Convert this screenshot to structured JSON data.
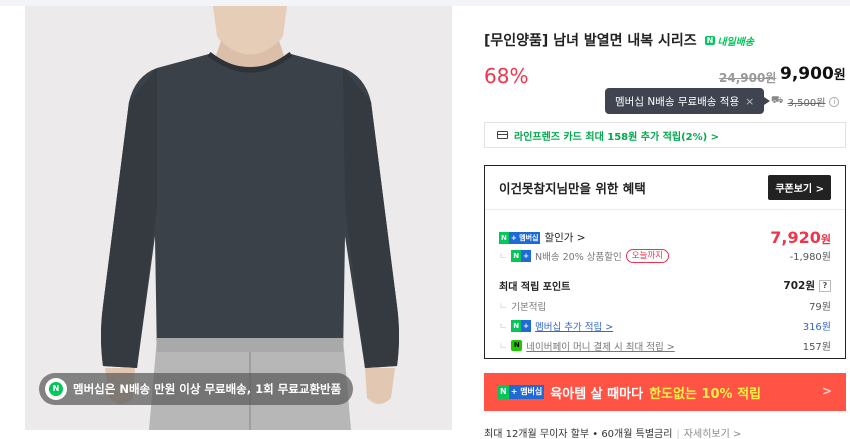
{
  "promo": {
    "text": "멤버십은 N배송 만원 이상 무료배송, 1회 무료교환반품",
    "icon": "N"
  },
  "product": {
    "title": "[무인양품] 남녀 발열면 내복 시리즈",
    "delivery_badge": "내일배송",
    "discount": "68%",
    "original_price": "24,900원",
    "sale_price_num": "9,900",
    "sale_price_unit": "원"
  },
  "tooltip": {
    "text": "멤버십 N배송 무료배송 적용",
    "close": "×"
  },
  "shipping": {
    "fee": "3,500원",
    "info": "i"
  },
  "card_benefit": {
    "text": "라인프렌즈 카드 최대 158원 추가 적립(2%) >"
  },
  "benefit": {
    "title": "이건못참지님만을 위한 혜택",
    "coupon_button": "쿠폰보기 >",
    "badge_n": "N",
    "badge_plus": "+ 멤버십",
    "discount_label": "할인가 >",
    "discount_price_num": "7,920",
    "discount_price_unit": "원",
    "nship_label": "N배송 20% 상품할인",
    "nship_tag": "오늘까지",
    "nship_value": "-1,980원",
    "points_label": "최대 적립 포인트",
    "points_value": "702원",
    "points_help": "?",
    "basic_label": "기본적립",
    "basic_value": "79원",
    "member_label": "멤버십 추가 적립 >",
    "member_value": "316원",
    "npay_label": "네이버페이 머니 결제 시 최대 적립 >",
    "npay_value": "157원"
  },
  "banner": {
    "badge": "N + 멤버십",
    "text": "육아템 살 때마다",
    "highlight": "한도없는 10% 적립",
    "arrow": ">"
  },
  "installment": {
    "text": "최대 12개월 무이자 할부 • 60개월 특별금리",
    "more": "자세히보기 >"
  }
}
